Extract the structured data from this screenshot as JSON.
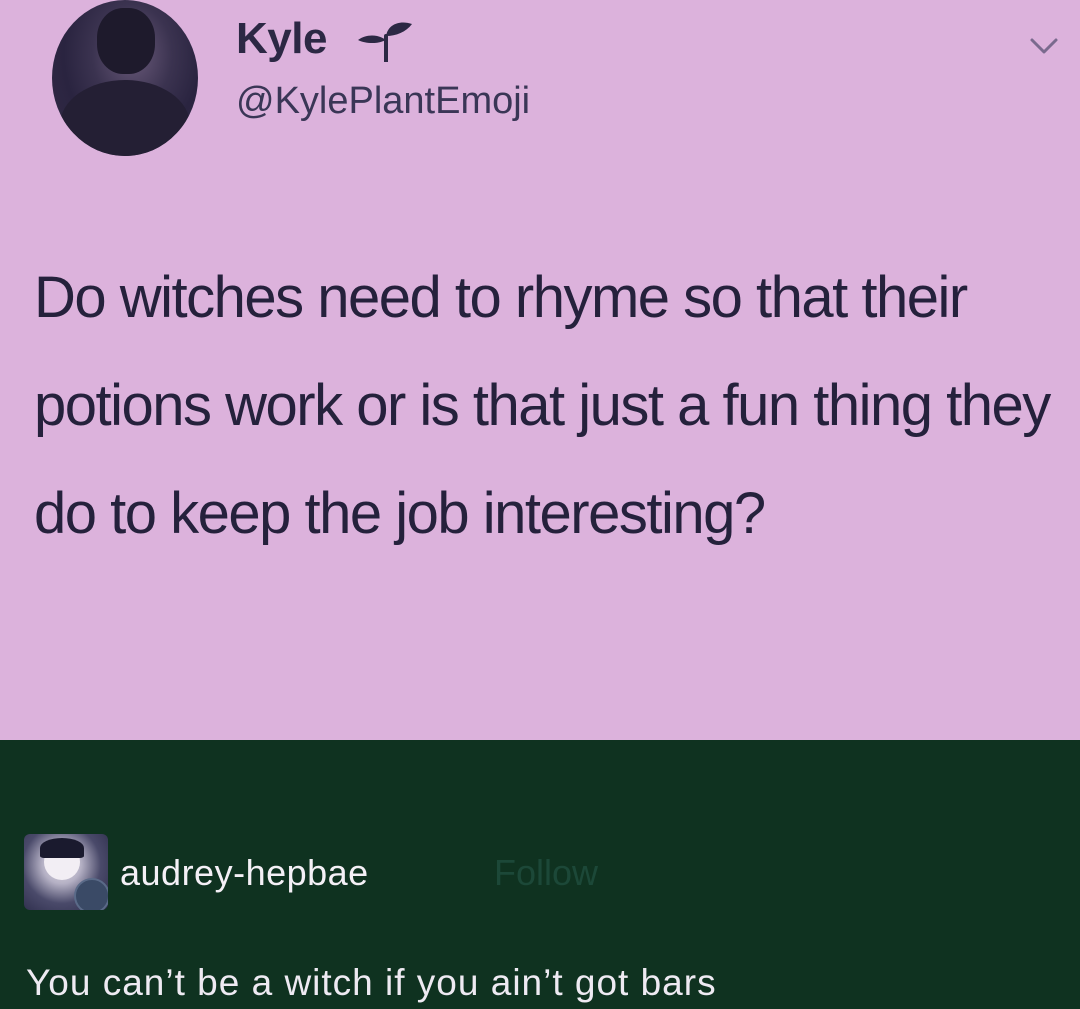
{
  "tweet": {
    "display_name": "Kyle",
    "handle": "@KylePlantEmoji",
    "name_emoji_icon": "seedling-icon",
    "menu_icon": "chevron-down-icon",
    "text": "Do witches need to rhyme so that their potions work or is that just a fun thing they do to keep the job interesting?",
    "background_color": "#dcb2dc",
    "text_color": "#25213c"
  },
  "reply": {
    "username": "audrey-hepbae",
    "follow_label": "Follow",
    "text": "You can’t be a witch if you ain’t got bars",
    "background_color": "#0f3220",
    "text_color": "#eeeaf2"
  }
}
